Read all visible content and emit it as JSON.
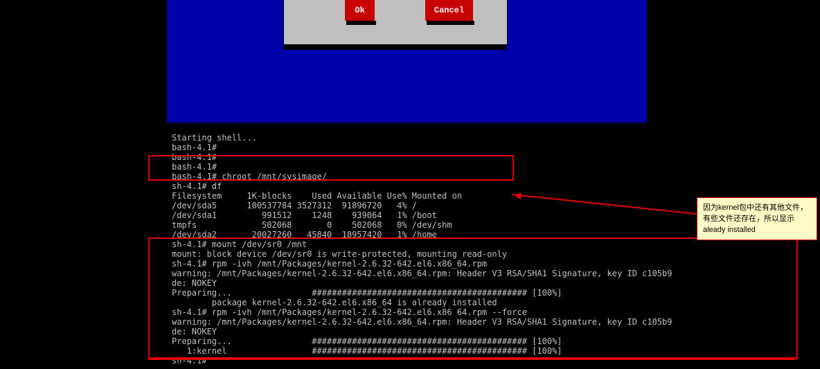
{
  "dialog": {
    "ok": "Ok",
    "cancel": "Cancel"
  },
  "note": {
    "text": "因为kernel包中还有其他文件，有些文件还存在，所以显示aleady installed"
  },
  "terminal": {
    "lines": [
      "Starting shell...",
      "bash-4.1#",
      "bash-4.1#",
      "bash-4.1#",
      "bash-4.1# chroot /mnt/sysimage/",
      "sh-4.1# df",
      "Filesystem     1K-blocks    Used Available Use% Mounted on",
      "/dev/sda5      100537784 3527312  91896720   4% /",
      "/dev/sda1         991512    1248    939064   1% /boot",
      "tmpfs             502068       0    502068   0% /dev/shm",
      "/dev/sda2       20027260   45840  18957420   1% /home",
      "sh-4.1# mount /dev/sr0 /mnt",
      "mount: block device /dev/sr0 is write-protected, mounting read-only",
      "sh-4.1# rpm -ivh /mnt/Packages/kernel-2.6.32-642.el6.x86_64.rpm",
      "warning: /mnt/Packages/kernel-2.6.32-642.el6.x86_64.rpm: Header V3 RSA/SHA1 Signature, key ID c105b9",
      "de: NOKEY",
      "Preparing...                ########################################### [100%]",
      "        package kernel-2.6.32-642.el6.x86_64 is already installed",
      "sh-4.1# rpm -ivh /mnt/Packages/kernel-2.6.32-642.el6.x86 64.rpm --force",
      "warning: /mnt/Packages/kernel-2.6.32-642.el6.x86_64.rpm: Header V3 RSA/SHA1 Signature, key ID c105b9",
      "de: NOKEY",
      "Preparing...                ########################################### [100%]",
      "   1:kernel                 ########################################### [100%]",
      "sh-4.1#"
    ]
  }
}
